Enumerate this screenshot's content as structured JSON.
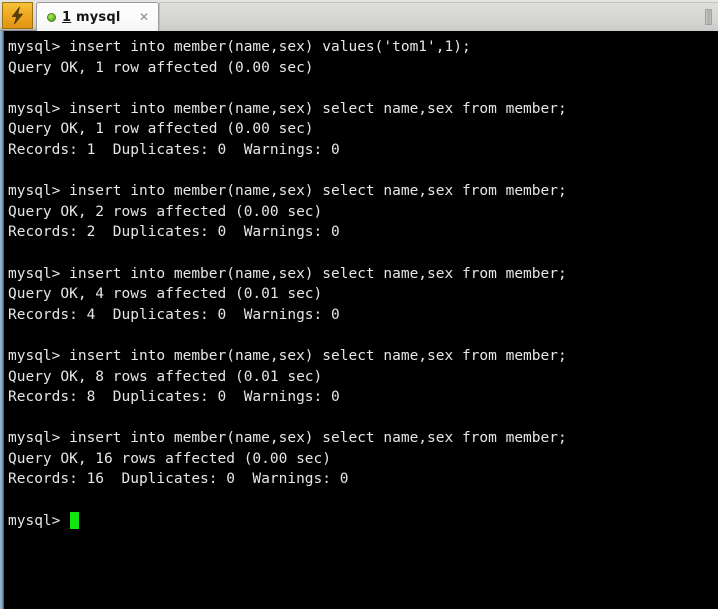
{
  "window": {
    "app_icon": "lightning-bolt-icon",
    "accent_color": "#efa81f",
    "tabbar_bg": "#dcdcda"
  },
  "tabbar": {
    "tabs": [
      {
        "index": "1",
        "title": "mysql",
        "status": "connected",
        "status_color": "#74c92a",
        "close_label": "✕"
      }
    ],
    "scroll_button": "tab-scroll-right"
  },
  "terminal": {
    "background": "#000000",
    "foreground": "#e6e6e6",
    "cursor_color": "#12e412",
    "prompt": "mysql> ",
    "lines": [
      "mysql> insert into member(name,sex) values('tom1',1);",
      "Query OK, 1 row affected (0.00 sec)",
      "",
      "mysql> insert into member(name,sex) select name,sex from member;",
      "Query OK, 1 row affected (0.00 sec)",
      "Records: 1  Duplicates: 0  Warnings: 0",
      "",
      "mysql> insert into member(name,sex) select name,sex from member;",
      "Query OK, 2 rows affected (0.00 sec)",
      "Records: 2  Duplicates: 0  Warnings: 0",
      "",
      "mysql> insert into member(name,sex) select name,sex from member;",
      "Query OK, 4 rows affected (0.01 sec)",
      "Records: 4  Duplicates: 0  Warnings: 0",
      "",
      "mysql> insert into member(name,sex) select name,sex from member;",
      "Query OK, 8 rows affected (0.01 sec)",
      "Records: 8  Duplicates: 0  Warnings: 0",
      "",
      "mysql> insert into member(name,sex) select name,sex from member;",
      "Query OK, 16 rows affected (0.00 sec)",
      "Records: 16  Duplicates: 0  Warnings: 0",
      ""
    ],
    "current_prompt": "mysql> ",
    "current_input": ""
  }
}
